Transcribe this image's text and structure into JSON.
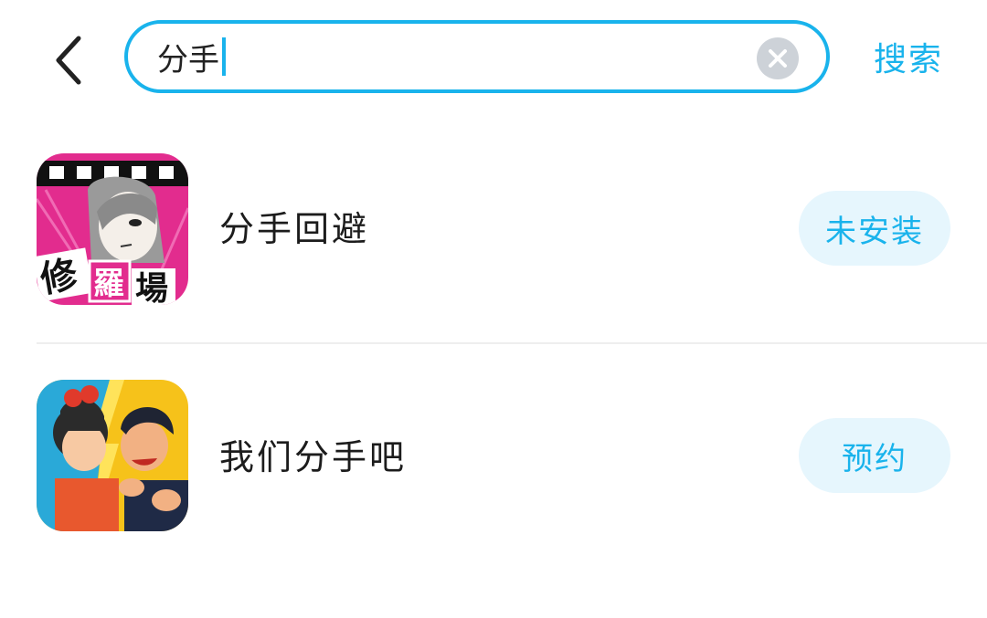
{
  "header": {
    "search_value": "分手",
    "search_button_label": "搜索"
  },
  "results": [
    {
      "name": "分手回避",
      "action_label": "未安装",
      "icon_caption": [
        "修",
        "羅",
        "場"
      ]
    },
    {
      "name": "我们分手吧",
      "action_label": "预约"
    }
  ],
  "colors": {
    "accent": "#19b3ec",
    "button_bg": "#e6f6fd",
    "clear_icon_bg": "#cdd2d8",
    "divider": "#eeeeee"
  },
  "icons": {
    "back": "chevron-left-icon",
    "clear": "close-circle-icon"
  }
}
